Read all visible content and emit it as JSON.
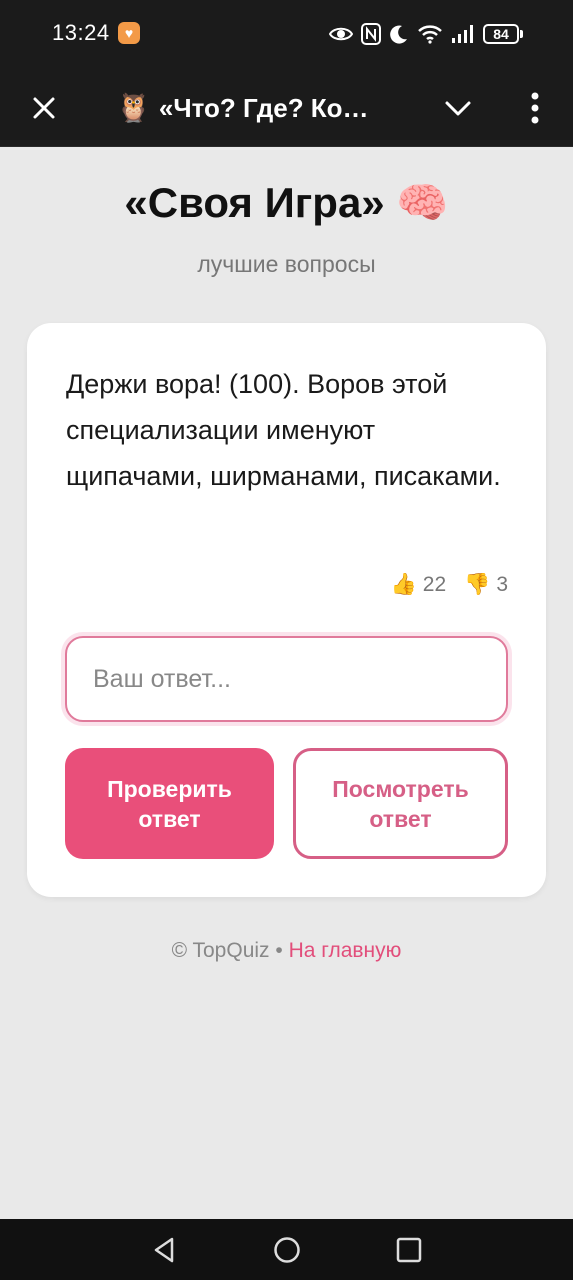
{
  "status_bar": {
    "time": "13:24",
    "battery": "84",
    "icons": [
      "notification-heart-icon",
      "eye-icon",
      "nfc-icon",
      "moon-icon",
      "wifi-icon",
      "signal-icon",
      "battery-icon"
    ]
  },
  "app_bar": {
    "owl_emoji": "🦉",
    "title": "«Что? Где? Ко…"
  },
  "page": {
    "title": "«Своя Игра» 🧠",
    "subtitle": "лучшие вопросы"
  },
  "question": {
    "text": "Держи вора! (100). Воров этой специализации именуют щипачами, ширманами, писаками.",
    "likes": "22",
    "dislikes": "3",
    "like_emoji": "👍",
    "dislike_emoji": "👎"
  },
  "answer": {
    "placeholder": "Ваш ответ...",
    "value": ""
  },
  "buttons": {
    "check": "Проверить ответ",
    "show": "Посмотреть ответ"
  },
  "footer": {
    "copyright": "© TopQuiz",
    "separator": " • ",
    "home_link": "На главную"
  },
  "colors": {
    "accent": "#e94f7a",
    "accent_border": "#d65f86",
    "background": "#e9e9e9",
    "topbar": "#1b1b1b"
  }
}
